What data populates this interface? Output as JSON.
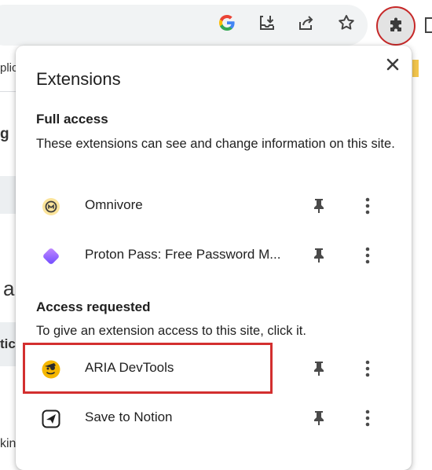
{
  "toolbar": {
    "icons": [
      "google-icon",
      "install-app-icon",
      "share-icon",
      "bookmark-star-icon"
    ],
    "extensions_icon": "puzzle-piece-icon"
  },
  "background": {
    "fragment_1": "plic",
    "fragment_2": "g",
    "fragment_3": "a",
    "fragment_4": "tic",
    "fragment_5": "kin"
  },
  "popup": {
    "title": "Extensions",
    "close_icon": "close-icon",
    "full_access": {
      "heading": "Full access",
      "description": "These extensions can see and change information on this site.",
      "items": [
        {
          "name": "Omnivore",
          "icon": "omnivore-icon"
        },
        {
          "name": "Proton Pass: Free Password M...",
          "icon": "proton-pass-icon"
        }
      ]
    },
    "access_requested": {
      "heading": "Access requested",
      "description": "To give an extension access to this site, click it.",
      "items": [
        {
          "name": "ARIA DevTools",
          "icon": "aria-devtools-icon"
        },
        {
          "name": "Save to Notion",
          "icon": "save-to-notion-icon"
        }
      ]
    },
    "pin_icon": "pin-icon",
    "more_icon": "more-vertical-icon"
  },
  "colors": {
    "highlight": "#d32f2f",
    "omnivore": "#fbe49b",
    "aria": "#f5b700",
    "proton_start": "#b06bff",
    "proton_end": "#6d4aff"
  }
}
